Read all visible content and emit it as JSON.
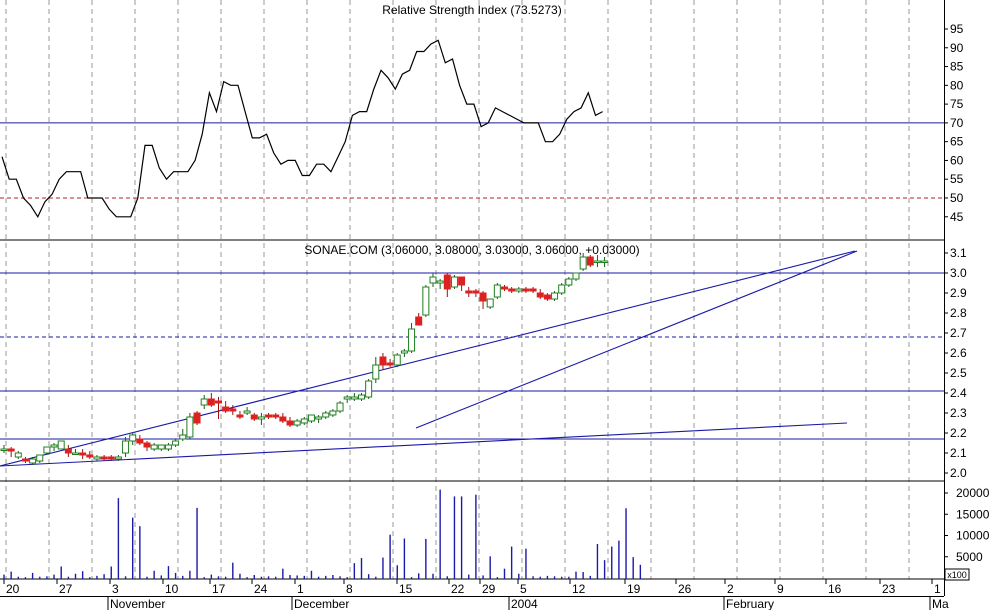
{
  "chart_data": [
    {
      "type": "line",
      "title": "Relative Strength Index (73.5273)",
      "ylim": [
        40,
        97
      ],
      "y_ticks": [
        "95",
        "90",
        "85",
        "80",
        "75",
        "70",
        "65",
        "60",
        "55",
        "50",
        "45"
      ],
      "reference_lines": [
        {
          "value": 70,
          "style": "solid",
          "color": "#1a1aa8"
        },
        {
          "value": 50,
          "style": "dashed",
          "color": "#b02020"
        }
      ],
      "series": [
        {
          "values": [
            61,
            55,
            55,
            50,
            48,
            45,
            49,
            51,
            55,
            57,
            57,
            57,
            50,
            50,
            50,
            47,
            45,
            45,
            45,
            50,
            64,
            64,
            58,
            55,
            57,
            57,
            57,
            60,
            67,
            78,
            73,
            81,
            80,
            80,
            73,
            66,
            66,
            67,
            62,
            59,
            60,
            60,
            56,
            56,
            59,
            59,
            57,
            61,
            65,
            72,
            73,
            73,
            79,
            84,
            82,
            79,
            83,
            84,
            89,
            89,
            91,
            92,
            86,
            87,
            80,
            75,
            75,
            69,
            70,
            74,
            73,
            72,
            71,
            70,
            70,
            70,
            65,
            65,
            67,
            71,
            73,
            74,
            78,
            72,
            73
          ]
        }
      ],
      "x_ticks": [
        "20",
        "27",
        "3",
        "10",
        "17",
        "24",
        "1",
        "8",
        "15",
        "22",
        "29",
        "5",
        "12",
        "19",
        "26",
        "2",
        "9",
        "16",
        "23",
        "1"
      ],
      "month_labels": [
        "November",
        "December",
        "2004",
        "February",
        "Ma"
      ],
      "grid": true,
      "colors": {
        "line": "#000000",
        "grid": "#9a9a9a"
      }
    },
    {
      "type": "candlestick",
      "title": "SONAE.COM (3.06000, 3.08000, 3.03000, 3.06000, +0.03000)",
      "ylim": [
        1.95,
        3.18
      ],
      "y_ticks": [
        "3.1",
        "3.0",
        "2.9",
        "2.8",
        "2.7",
        "2.6",
        "2.5",
        "2.4",
        "2.3",
        "2.2",
        "2.1",
        "2.0"
      ],
      "horizontal_lines": [
        {
          "value": 3.0,
          "style": "solid"
        },
        {
          "value": 2.68,
          "style": "dashed"
        },
        {
          "value": 2.41,
          "style": "solid"
        },
        {
          "value": 2.17,
          "style": "solid"
        }
      ],
      "trend_lines": [
        {
          "from": [
            0,
            2.035
          ],
          "to": [
            84,
            3.11
          ]
        },
        {
          "from": [
            0,
            2.035
          ],
          "to": [
            84,
            2.25
          ]
        },
        {
          "from": [
            41,
            2.225
          ],
          "to": [
            84,
            3.11
          ]
        }
      ],
      "candles": [
        {
          "o": 2.12,
          "h": 2.14,
          "l": 2.1,
          "c": 2.12
        },
        {
          "o": 2.12,
          "h": 2.13,
          "l": 2.08,
          "c": 2.11
        },
        {
          "o": 2.08,
          "h": 2.11,
          "l": 2.07,
          "c": 2.1
        },
        {
          "o": 2.07,
          "h": 2.08,
          "l": 2.05,
          "c": 2.06
        },
        {
          "o": 2.05,
          "h": 2.08,
          "l": 2.04,
          "c": 2.07
        },
        {
          "o": 2.06,
          "h": 2.09,
          "l": 2.05,
          "c": 2.09
        },
        {
          "o": 2.1,
          "h": 2.13,
          "l": 2.09,
          "c": 2.13
        },
        {
          "o": 2.13,
          "h": 2.15,
          "l": 2.11,
          "c": 2.14
        },
        {
          "o": 2.12,
          "h": 2.16,
          "l": 2.12,
          "c": 2.16
        },
        {
          "o": 2.12,
          "h": 2.14,
          "l": 2.08,
          "c": 2.1
        },
        {
          "o": 2.1,
          "h": 2.12,
          "l": 2.09,
          "c": 2.1
        },
        {
          "o": 2.1,
          "h": 2.12,
          "l": 2.07,
          "c": 2.09
        },
        {
          "o": 2.09,
          "h": 2.11,
          "l": 2.07,
          "c": 2.08
        },
        {
          "o": 2.07,
          "h": 2.09,
          "l": 2.06,
          "c": 2.08
        },
        {
          "o": 2.08,
          "h": 2.09,
          "l": 2.06,
          "c": 2.07
        },
        {
          "o": 2.08,
          "h": 2.09,
          "l": 2.06,
          "c": 2.07
        },
        {
          "o": 2.07,
          "h": 2.09,
          "l": 2.06,
          "c": 2.08
        },
        {
          "o": 2.1,
          "h": 2.18,
          "l": 2.08,
          "c": 2.16
        },
        {
          "o": 2.16,
          "h": 2.2,
          "l": 2.14,
          "c": 2.19
        },
        {
          "o": 2.17,
          "h": 2.19,
          "l": 2.14,
          "c": 2.15
        },
        {
          "o": 2.15,
          "h": 2.16,
          "l": 2.11,
          "c": 2.13
        },
        {
          "o": 2.12,
          "h": 2.15,
          "l": 2.11,
          "c": 2.14
        },
        {
          "o": 2.12,
          "h": 2.14,
          "l": 2.11,
          "c": 2.14
        },
        {
          "o": 2.12,
          "h": 2.15,
          "l": 2.11,
          "c": 2.14
        },
        {
          "o": 2.14,
          "h": 2.17,
          "l": 2.13,
          "c": 2.16
        },
        {
          "o": 2.17,
          "h": 2.22,
          "l": 2.16,
          "c": 2.19
        },
        {
          "o": 2.18,
          "h": 2.3,
          "l": 2.17,
          "c": 2.28
        },
        {
          "o": 2.3,
          "h": 2.31,
          "l": 2.24,
          "c": 2.25
        },
        {
          "o": 2.34,
          "h": 2.39,
          "l": 2.32,
          "c": 2.37
        },
        {
          "o": 2.37,
          "h": 2.4,
          "l": 2.33,
          "c": 2.34
        },
        {
          "o": 2.36,
          "h": 2.38,
          "l": 2.27,
          "c": 2.35
        },
        {
          "o": 2.33,
          "h": 2.36,
          "l": 2.3,
          "c": 2.31
        },
        {
          "o": 2.32,
          "h": 2.34,
          "l": 2.29,
          "c": 2.31
        },
        {
          "o": 2.29,
          "h": 2.31,
          "l": 2.27,
          "c": 2.28
        },
        {
          "o": 2.3,
          "h": 2.33,
          "l": 2.29,
          "c": 2.31
        },
        {
          "o": 2.29,
          "h": 2.3,
          "l": 2.26,
          "c": 2.27
        },
        {
          "o": 2.27,
          "h": 2.3,
          "l": 2.24,
          "c": 2.28
        },
        {
          "o": 2.29,
          "h": 2.3,
          "l": 2.27,
          "c": 2.28
        },
        {
          "o": 2.29,
          "h": 2.3,
          "l": 2.27,
          "c": 2.28
        },
        {
          "o": 2.28,
          "h": 2.3,
          "l": 2.25,
          "c": 2.26
        },
        {
          "o": 2.26,
          "h": 2.28,
          "l": 2.23,
          "c": 2.24
        },
        {
          "o": 2.24,
          "h": 2.27,
          "l": 2.23,
          "c": 2.26
        },
        {
          "o": 2.25,
          "h": 2.28,
          "l": 2.24,
          "c": 2.27
        },
        {
          "o": 2.26,
          "h": 2.29,
          "l": 2.25,
          "c": 2.29
        },
        {
          "o": 2.27,
          "h": 2.29,
          "l": 2.25,
          "c": 2.28
        },
        {
          "o": 2.28,
          "h": 2.31,
          "l": 2.27,
          "c": 2.3
        },
        {
          "o": 2.29,
          "h": 2.32,
          "l": 2.28,
          "c": 2.31
        },
        {
          "o": 2.31,
          "h": 2.36,
          "l": 2.3,
          "c": 2.35
        },
        {
          "o": 2.37,
          "h": 2.39,
          "l": 2.35,
          "c": 2.38
        },
        {
          "o": 2.37,
          "h": 2.4,
          "l": 2.36,
          "c": 2.38
        },
        {
          "o": 2.37,
          "h": 2.4,
          "l": 2.36,
          "c": 2.39
        },
        {
          "o": 2.38,
          "h": 2.47,
          "l": 2.37,
          "c": 2.46
        },
        {
          "o": 2.47,
          "h": 2.58,
          "l": 2.45,
          "c": 2.54
        },
        {
          "o": 2.58,
          "h": 2.6,
          "l": 2.52,
          "c": 2.54
        },
        {
          "o": 2.55,
          "h": 2.57,
          "l": 2.53,
          "c": 2.54
        },
        {
          "o": 2.54,
          "h": 2.6,
          "l": 2.53,
          "c": 2.59
        },
        {
          "o": 2.6,
          "h": 2.62,
          "l": 2.58,
          "c": 2.61
        },
        {
          "o": 2.61,
          "h": 2.75,
          "l": 2.6,
          "c": 2.72
        },
        {
          "o": 2.78,
          "h": 2.8,
          "l": 2.74,
          "c": 2.74
        },
        {
          "o": 2.79,
          "h": 2.94,
          "l": 2.78,
          "c": 2.93
        },
        {
          "o": 2.95,
          "h": 3.0,
          "l": 2.93,
          "c": 2.98
        },
        {
          "o": 2.95,
          "h": 2.97,
          "l": 2.92,
          "c": 2.96
        },
        {
          "o": 2.99,
          "h": 3.0,
          "l": 2.88,
          "c": 2.92
        },
        {
          "o": 2.93,
          "h": 2.99,
          "l": 2.92,
          "c": 2.98
        },
        {
          "o": 2.98,
          "h": 2.98,
          "l": 2.91,
          "c": 2.94
        },
        {
          "o": 2.91,
          "h": 2.93,
          "l": 2.88,
          "c": 2.9
        },
        {
          "o": 2.91,
          "h": 2.92,
          "l": 2.88,
          "c": 2.9
        },
        {
          "o": 2.9,
          "h": 2.91,
          "l": 2.82,
          "c": 2.86
        },
        {
          "o": 2.83,
          "h": 2.87,
          "l": 2.82,
          "c": 2.87
        },
        {
          "o": 2.88,
          "h": 2.95,
          "l": 2.87,
          "c": 2.94
        },
        {
          "o": 2.93,
          "h": 2.94,
          "l": 2.91,
          "c": 2.92
        },
        {
          "o": 2.92,
          "h": 2.93,
          "l": 2.9,
          "c": 2.91
        },
        {
          "o": 2.91,
          "h": 2.93,
          "l": 2.9,
          "c": 2.92
        },
        {
          "o": 2.92,
          "h": 2.93,
          "l": 2.9,
          "c": 2.91
        },
        {
          "o": 2.92,
          "h": 2.93,
          "l": 2.9,
          "c": 2.91
        },
        {
          "o": 2.9,
          "h": 2.92,
          "l": 2.87,
          "c": 2.88
        },
        {
          "o": 2.89,
          "h": 2.9,
          "l": 2.86,
          "c": 2.87
        },
        {
          "o": 2.87,
          "h": 2.91,
          "l": 2.86,
          "c": 2.9
        },
        {
          "o": 2.9,
          "h": 2.95,
          "l": 2.89,
          "c": 2.94
        },
        {
          "o": 2.94,
          "h": 2.98,
          "l": 2.93,
          "c": 2.97
        },
        {
          "o": 2.97,
          "h": 3.0,
          "l": 2.96,
          "c": 3.0
        },
        {
          "o": 3.02,
          "h": 3.1,
          "l": 3.01,
          "c": 3.08
        },
        {
          "o": 3.08,
          "h": 3.09,
          "l": 3.03,
          "c": 3.04
        },
        {
          "o": 3.06,
          "h": 3.09,
          "l": 3.03,
          "c": 3.06
        },
        {
          "o": 3.06,
          "h": 3.08,
          "l": 3.03,
          "c": 3.06
        }
      ],
      "colors": {
        "up": "#208020",
        "down": "#dd2020",
        "trend": "#1a1aa8"
      }
    },
    {
      "type": "bar",
      "title": "",
      "ylim": [
        0,
        22000
      ],
      "y_ticks": [
        "20000",
        "15000",
        "10000",
        "5000"
      ],
      "unit_label": "x100",
      "values": [
        800,
        1500,
        300,
        200,
        1200,
        300,
        400,
        800,
        2700,
        300,
        1000,
        1600,
        200,
        500,
        900,
        2700,
        18800,
        400,
        14200,
        12200,
        300,
        1700,
        600,
        2800,
        1200,
        500,
        1700,
        16500,
        200,
        800,
        400,
        300,
        3600,
        1000,
        200,
        700,
        300,
        400,
        300,
        2200,
        700,
        600,
        500,
        1700,
        300,
        500,
        700,
        400,
        200,
        3500,
        4700,
        900,
        300,
        4800,
        10200,
        3000,
        9300,
        200,
        1100,
        9200,
        1000,
        20800,
        400,
        19200,
        19200,
        800,
        19600,
        600,
        5100,
        200,
        2200,
        7400,
        1000,
        6900,
        400,
        300,
        500,
        400,
        300,
        300,
        1500,
        1400,
        500,
        8000,
        4200,
        7400,
        8800,
        16400,
        4900,
        3100
      ],
      "colors": {
        "bar": "#1a1aa8"
      }
    }
  ]
}
